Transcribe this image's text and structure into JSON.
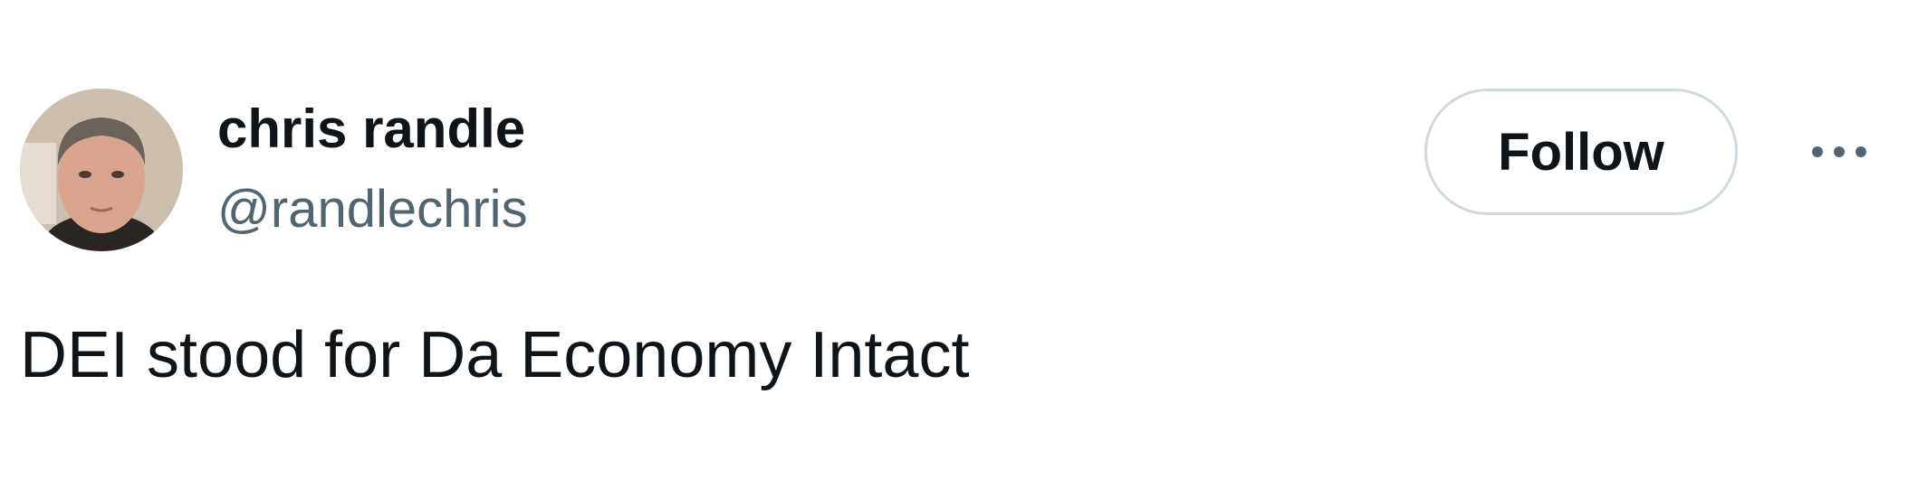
{
  "tweet": {
    "author": {
      "display_name": "chris randle",
      "handle": "@randlechris"
    },
    "follow_label": "Follow",
    "text": "DEI stood for Da Economy Intact"
  },
  "icons": {
    "more": "more-options-icon",
    "avatar": "profile-photo"
  },
  "colors": {
    "primary_text": "#0f1419",
    "secondary_text": "#536471",
    "button_border": "#cfd9de",
    "background": "#ffffff"
  }
}
